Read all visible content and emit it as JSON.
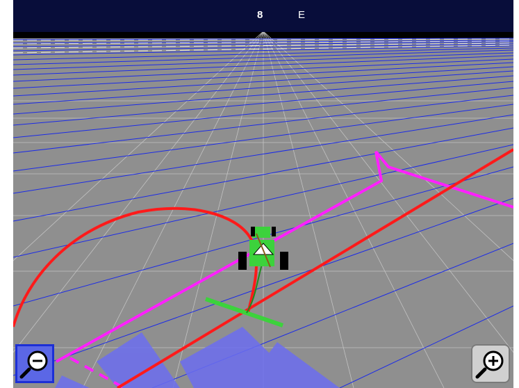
{
  "status_bar": {
    "heading_value": "8",
    "heading_direction": "E"
  },
  "controls": {
    "zoom_out_icon": "zoom-out-magnifier-icon",
    "zoom_in_icon": "zoom-in-magnifier-icon"
  },
  "colors": {
    "sky": "#000000",
    "status_bar": "#080d3a",
    "ground": "#8f8f8f",
    "grid_blue": "#1a2ae8",
    "grid_white": "#c8c8c8",
    "guidance_line": "#ff20ff",
    "path_line": "#ff1a1a",
    "coverage": "#6c6ef0",
    "vehicle": "#3cd23c"
  }
}
